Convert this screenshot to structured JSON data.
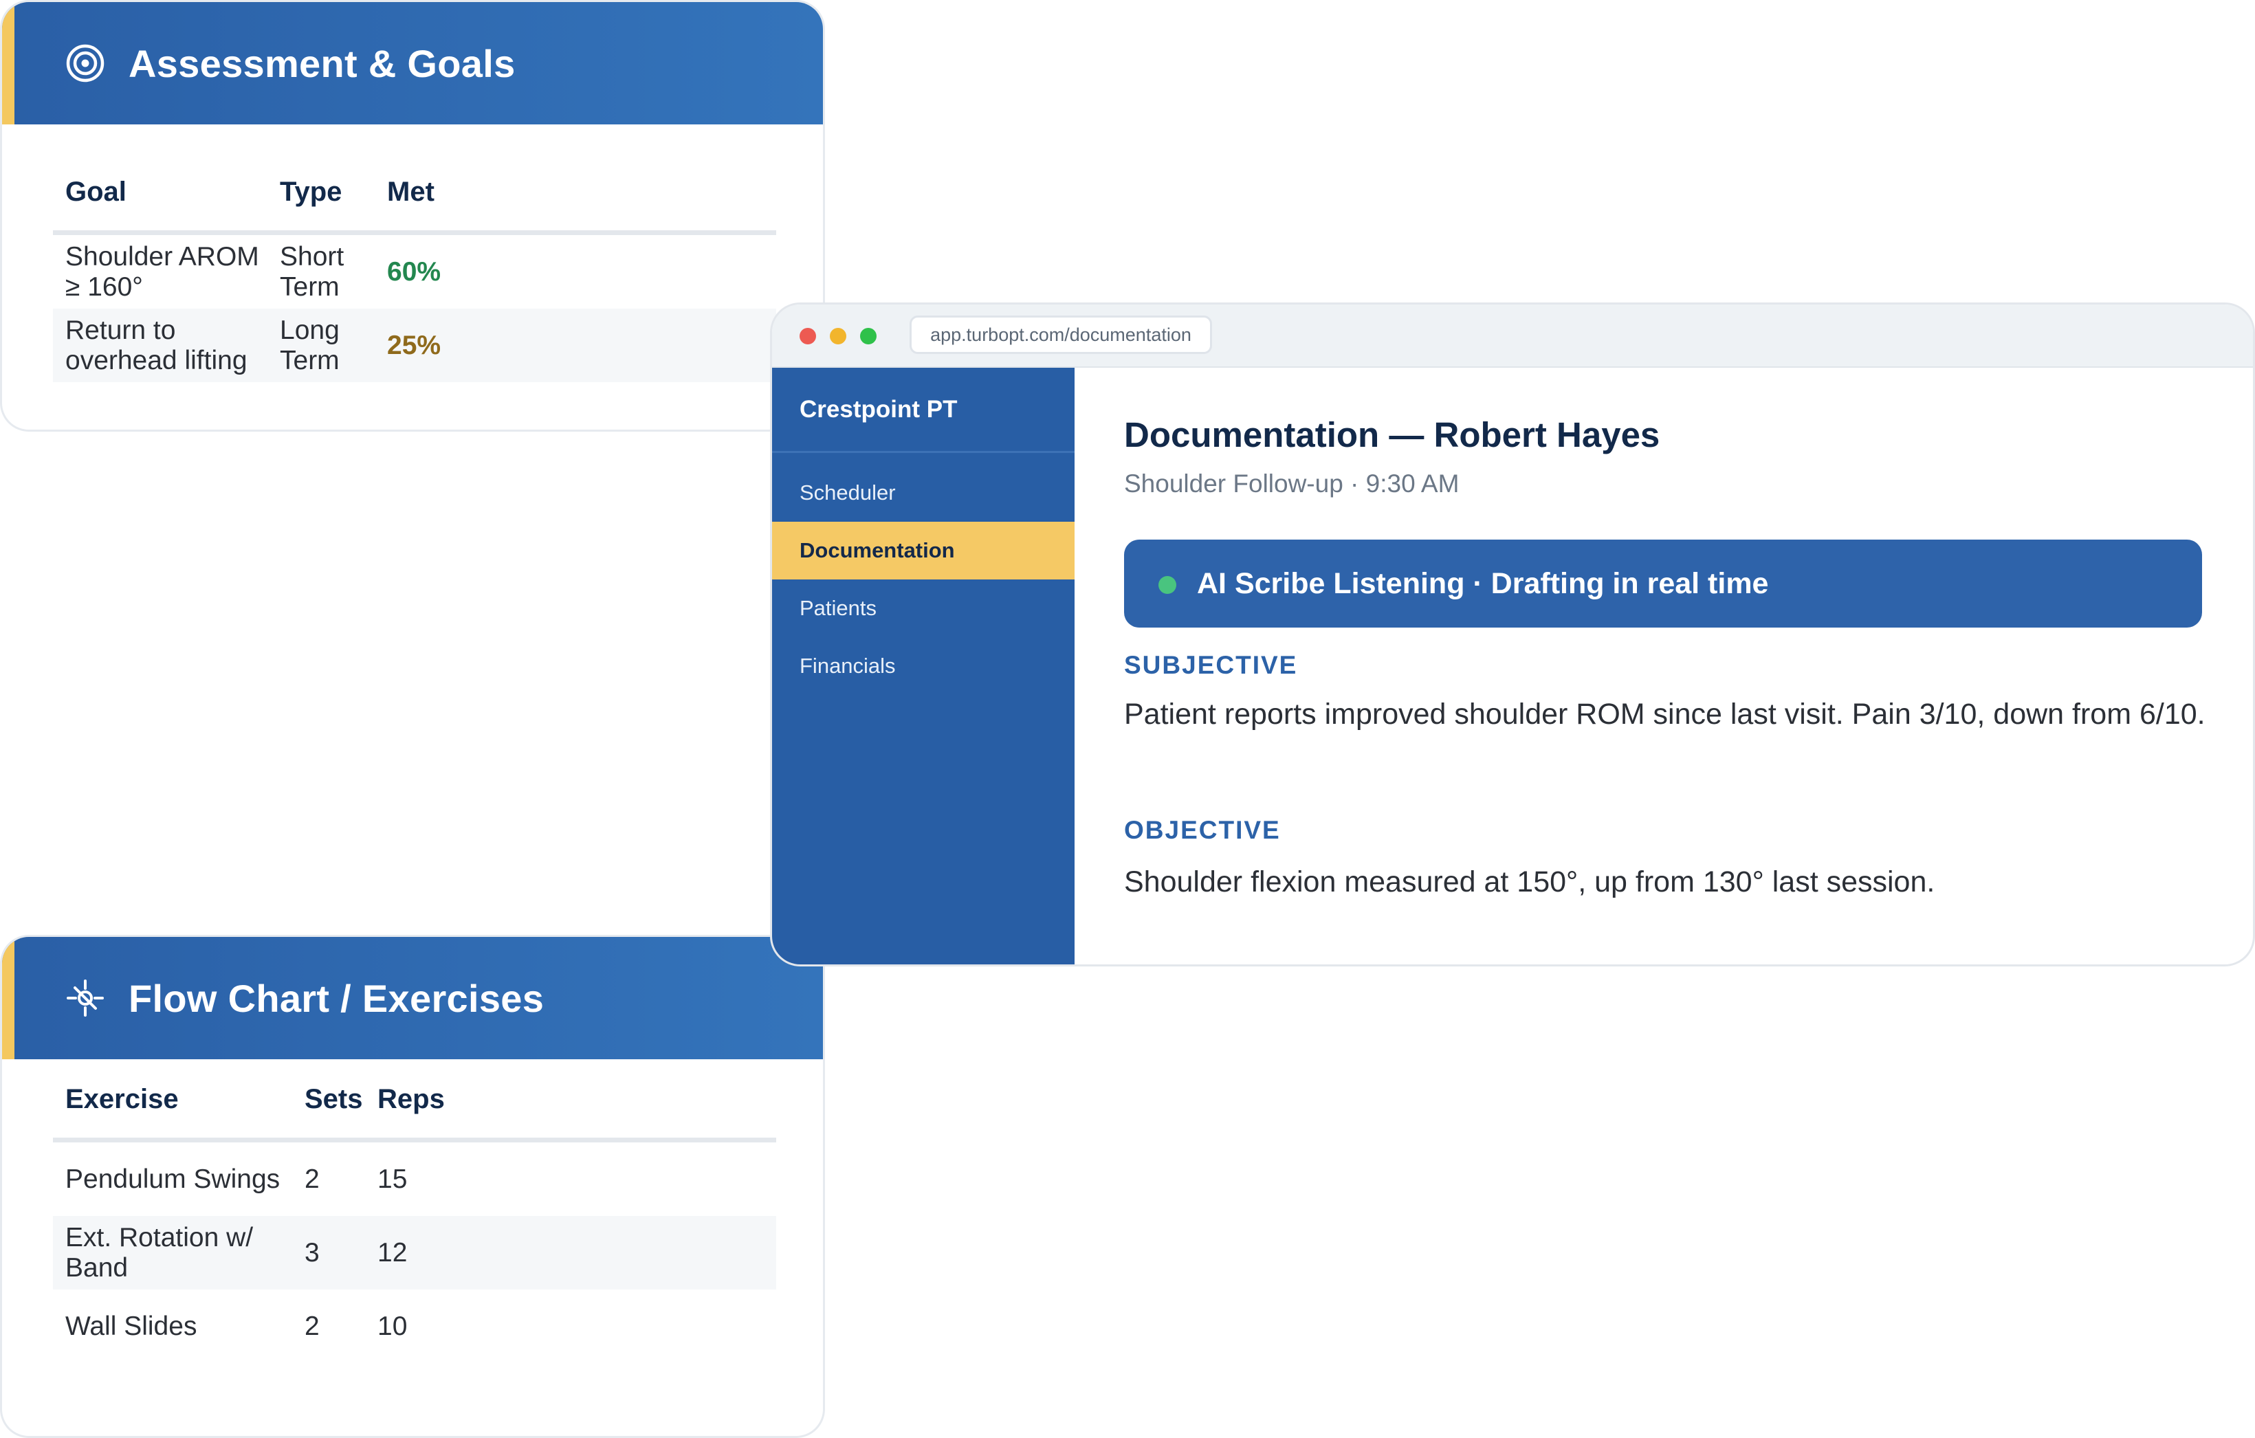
{
  "goals_card": {
    "title": "Assessment & Goals",
    "icon": "target-icon",
    "columns": [
      "Goal",
      "Type",
      "Met"
    ],
    "rows": [
      {
        "goal": "Shoulder AROM ≥ 160°",
        "type": "Short Term",
        "met": "60%",
        "met_color": "#23874f"
      },
      {
        "goal": "Return to overhead lifting",
        "type": "Long Term",
        "met": "25%",
        "met_color": "#8f6a1c"
      }
    ]
  },
  "exercises_card": {
    "title": "Flow Chart / Exercises",
    "icon": "exercise-icon",
    "columns": [
      "Exercise",
      "Sets",
      "Reps"
    ],
    "rows": [
      {
        "exercise": "Pendulum Swings",
        "sets": "2",
        "reps": "15"
      },
      {
        "exercise": "Ext. Rotation w/ Band",
        "sets": "3",
        "reps": "12"
      },
      {
        "exercise": "Wall Slides",
        "sets": "2",
        "reps": "10"
      }
    ]
  },
  "app": {
    "url": "app.turbopt.com/documentation",
    "sidebar": {
      "brand": "Crestpoint PT",
      "items": [
        {
          "label": "Scheduler",
          "active": false
        },
        {
          "label": "Documentation",
          "active": true
        },
        {
          "label": "Patients",
          "active": false
        },
        {
          "label": "Financials",
          "active": false
        }
      ]
    },
    "main": {
      "title": "Documentation — Robert Hayes",
      "subtitle": "Shoulder Follow-up · 9:30 AM",
      "banner": "AI Scribe Listening · Drafting in real time",
      "subjective_label": "SUBJECTIVE",
      "subjective_text": "Patient reports improved shoulder ROM since last visit. Pain 3/10, down from 6/10.",
      "objective_label": "OBJECTIVE",
      "objective_text": "Shoulder flexion measured at 150°, up from 130° last session."
    }
  },
  "colors": {
    "header_blue": "#2a5fa6",
    "sidebar_blue": "#285ea5",
    "accent_yellow": "#f4c85f",
    "section_blue": "#2c62a8",
    "live_green": "#49c47f"
  }
}
